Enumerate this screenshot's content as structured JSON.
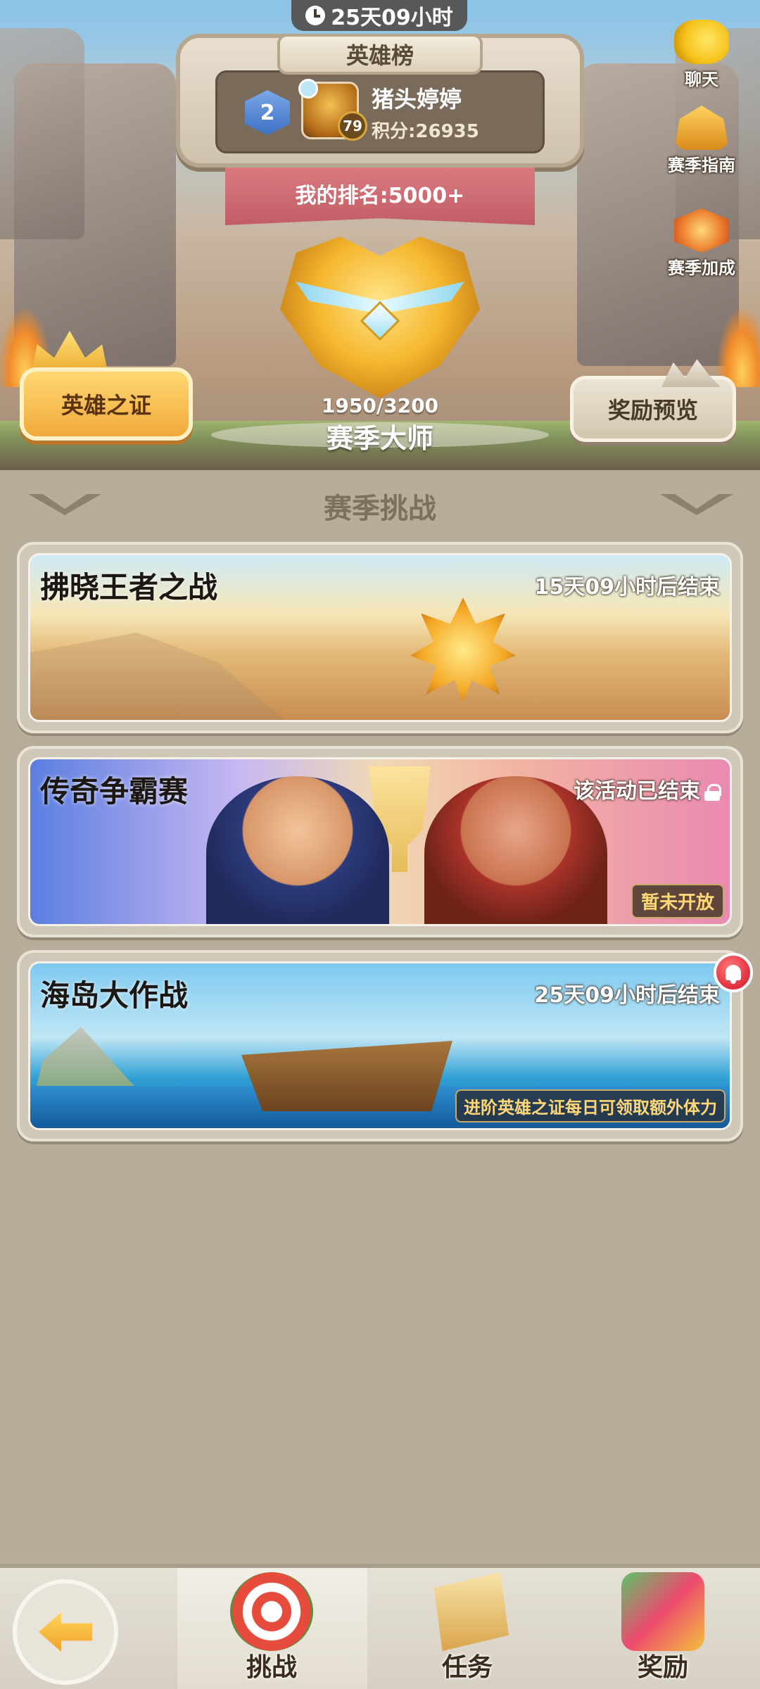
{
  "timer": {
    "text": "25天09小时"
  },
  "leaderboard": {
    "title": "英雄榜",
    "rank_badge": "2",
    "player_name": "猪头婷婷",
    "player_level": "79",
    "player_score": "积分:26935",
    "my_rank": "我的排名:5000+"
  },
  "season": {
    "progress": "1950/3200",
    "rank_name": "赛季大师"
  },
  "buttons": {
    "hero_proof": "英雄之证",
    "reward_preview": "奖励预览"
  },
  "side_menu": {
    "chat": "聊天",
    "guide": "赛季指南",
    "bonus": "赛季加成"
  },
  "section": {
    "title": "赛季挑战"
  },
  "challenges": [
    {
      "title": "拂晓王者之战",
      "time": "15天09小时后结束"
    },
    {
      "title": "传奇争霸赛",
      "time": "该活动已结束",
      "tag": "暂未开放"
    },
    {
      "title": "海岛大作战",
      "time": "25天09小时后结束",
      "tip": "进阶英雄之证每日可领取额外体力"
    }
  ],
  "nav": {
    "challenge": "挑战",
    "tasks": "任务",
    "rewards": "奖励"
  },
  "icons": {
    "timer": "clock-icon",
    "locked": "lock-icon",
    "notification": "bell-icon",
    "back": "back-arrow-icon"
  },
  "colors": {
    "page_bg": "#b7ad9a",
    "gold": "#f5b72e",
    "banner_red": "#c25d66",
    "tag_text": "#ffd777"
  }
}
